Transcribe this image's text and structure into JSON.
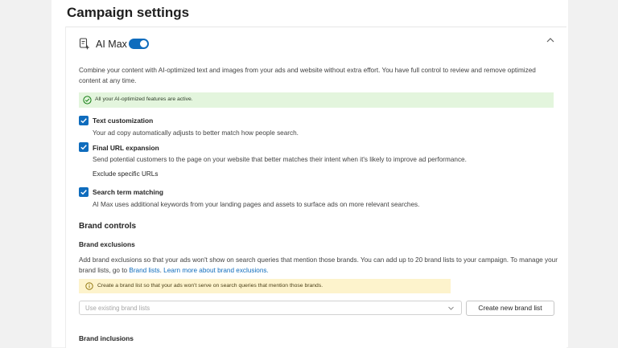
{
  "page": {
    "title": "Campaign settings"
  },
  "ai_max": {
    "title": "AI Max",
    "icon": "ai-sparkle-document-icon",
    "enabled": true,
    "description": "Combine your content with AI-optimized text and images from your ads and website without extra effort. You have full control to review and remove optimized content at any time.",
    "status_message": "All your AI-optimized features are active.",
    "options": [
      {
        "label": "Text customization",
        "description": "Your ad copy automatically adjusts to better match how people search.",
        "checked": true
      },
      {
        "label": "Final URL expansion",
        "description": "Send potential customers to the page on your website that better matches their intent when it's likely to improve ad performance.",
        "checked": true
      },
      {
        "label": "Search term matching",
        "description": "AI Max uses additional keywords from your landing pages and assets to surface ads on more relevant searches.",
        "checked": true
      }
    ],
    "exclude_urls_label": "Exclude specific URLs"
  },
  "brand_controls": {
    "title": "Brand controls",
    "exclusions": {
      "title": "Brand exclusions",
      "description_part1": "Add brand exclusions so that your ads won't show on search queries that mention those brands. You can add up to 20 brand lists to your campaign. To manage your brand lists, go to ",
      "link_brand_lists": "Brand lists",
      "separator": ". ",
      "link_learn_more": "Learn more about brand exclusions.",
      "warning": "Create a brand list so that your ads won't serve on search queries that mention those brands.",
      "select_placeholder": "Use existing brand lists",
      "create_button": "Create new brand list"
    },
    "inclusions": {
      "title": "Brand inclusions"
    }
  },
  "colors": {
    "accent": "#0f6cbd",
    "success_bg": "#e3f5dd",
    "warning_bg": "#fdf3cc"
  }
}
